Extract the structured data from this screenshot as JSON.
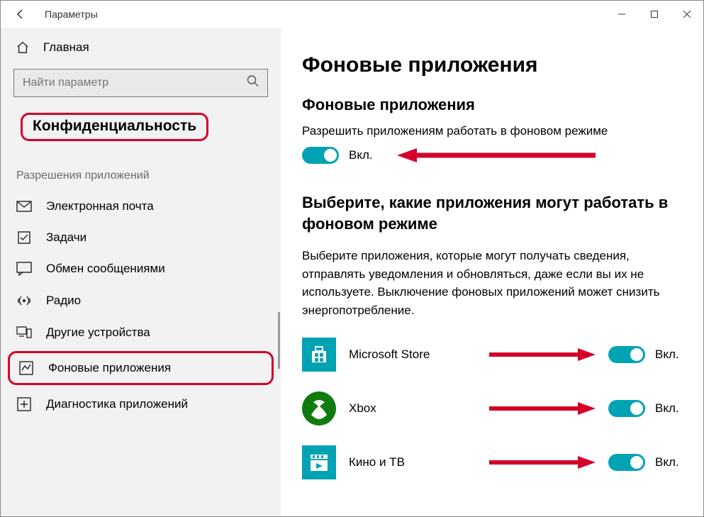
{
  "window": {
    "title": "Параметры"
  },
  "sidebar": {
    "home_label": "Главная",
    "search_placeholder": "Найти параметр",
    "category": "Конфиденциальность",
    "section_label": "Разрешения приложений",
    "items": [
      {
        "icon": "mail-icon",
        "label": "Электронная почта"
      },
      {
        "icon": "tasks-icon",
        "label": "Задачи"
      },
      {
        "icon": "messaging-icon",
        "label": "Обмен сообщениями"
      },
      {
        "icon": "radio-icon",
        "label": "Радио"
      },
      {
        "icon": "devices-icon",
        "label": "Другие устройства"
      },
      {
        "icon": "background-apps-icon",
        "label": "Фоновые приложения"
      },
      {
        "icon": "diagnostics-icon",
        "label": "Диагностика приложений"
      }
    ],
    "selected_index": 5
  },
  "main": {
    "page_title": "Фоновые приложения",
    "section1": {
      "title": "Фоновые приложения",
      "label": "Разрешить приложениям работать в фоновом режиме",
      "toggle_state": "Вкл."
    },
    "section2": {
      "title": "Выберите, какие приложения могут работать в фоновом режиме",
      "description": "Выберите приложения, которые могут получать сведения, отправлять уведомления и обновляться, даже если вы их не используете. Выключение фоновых приложений может снизить энергопотребление.",
      "apps": [
        {
          "name": "Microsoft Store",
          "icon_key": "store",
          "state": "Вкл."
        },
        {
          "name": "Xbox",
          "icon_key": "xbox",
          "state": "Вкл."
        },
        {
          "name": "Кино и ТВ",
          "icon_key": "movies",
          "state": "Вкл."
        }
      ]
    }
  },
  "colors": {
    "accent": "#00a3b4",
    "annotation": "#d4002a"
  }
}
